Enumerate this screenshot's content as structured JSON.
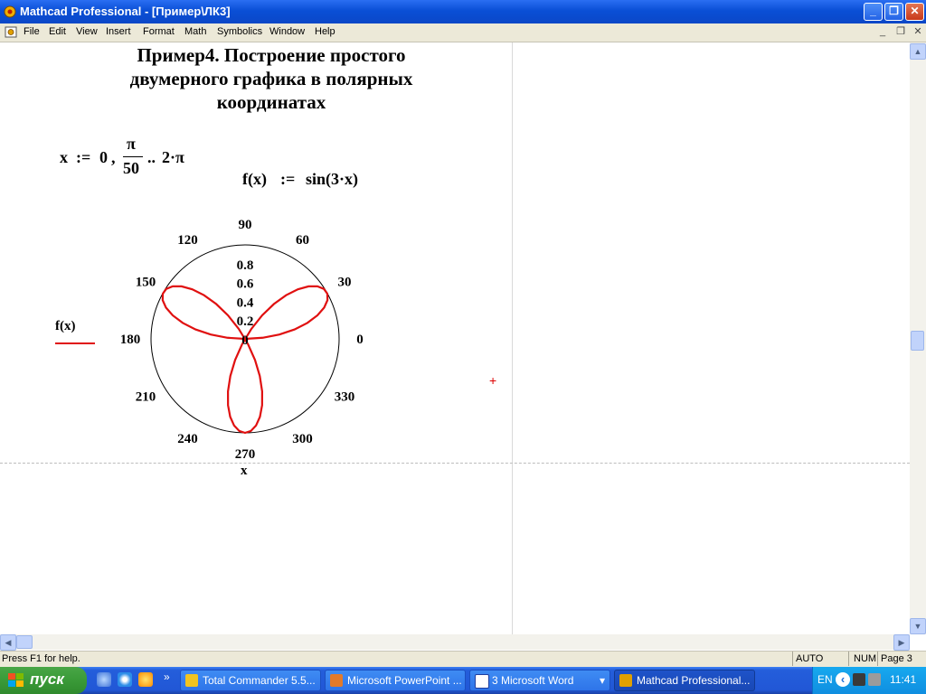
{
  "window": {
    "title": "Mathcad Professional - [Пример\\ЛК3]",
    "controls": {
      "minimize": "_",
      "maximize": "❐",
      "close": "✕"
    }
  },
  "menu": {
    "items": [
      "File",
      "Edit",
      "View",
      "Insert",
      "Format",
      "Math",
      "Symbolics",
      "Window",
      "Help"
    ],
    "mdi": {
      "minimize": "_",
      "restore": "❐",
      "close": "✕"
    }
  },
  "worksheet": {
    "heading": [
      "Пример4. Построение простого",
      "двумерного графика в полярных",
      "координатах"
    ],
    "range_def": {
      "var": "x",
      "assign": ":=",
      "start": "0",
      "comma": ",",
      "num": "π",
      "den": "50",
      "dots": "..",
      "end": "2·π"
    },
    "func_def": {
      "lhs": "f(x)",
      "assign": ":=",
      "rhs": "sin(3·x)"
    },
    "cursor": "+"
  },
  "chart_data": {
    "type": "polar",
    "function": "f(x) = sin(3·x)",
    "x_range": {
      "start": 0,
      "step": "π/50",
      "end": "2·π"
    },
    "angle_labels": [
      "90",
      "60",
      "30",
      "0",
      "330",
      "300",
      "270",
      "240",
      "210",
      "180",
      "150",
      "120"
    ],
    "angle_values": [
      90,
      60,
      30,
      0,
      330,
      300,
      270,
      240,
      210,
      180,
      150,
      120
    ],
    "radial_labels": [
      "0.8",
      "0.6",
      "0.4",
      "0.2",
      "0"
    ],
    "r_max": 1,
    "legend": "f(x)",
    "xlabel": "x",
    "series_color": "#e01010"
  },
  "status": {
    "help": "Press F1 for help.",
    "auto": "AUTO",
    "num": "NUM",
    "page": "Page 3"
  },
  "taskbar": {
    "start": "пуск",
    "chevron": "»",
    "tasks": [
      "Total Commander 5.5...",
      "Microsoft PowerPoint ...",
      "3 Microsoft Word",
      "Mathcad Professional..."
    ],
    "word_arrow": "▾",
    "lang": "EN",
    "tray_arrow": "‹",
    "time": "11:41"
  },
  "scroll": {
    "up": "▲",
    "down": "▼",
    "left": "◀",
    "right": "▶"
  }
}
